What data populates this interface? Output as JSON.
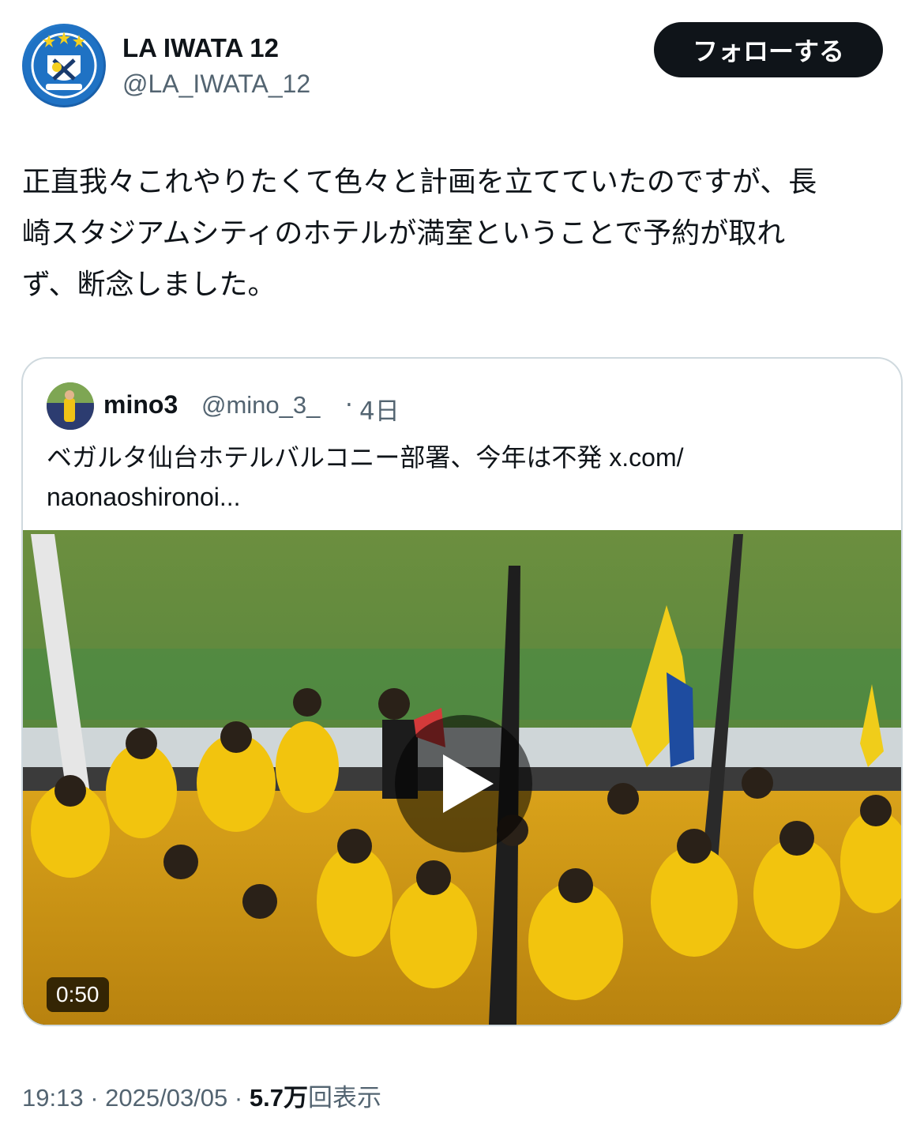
{
  "author": {
    "name": "LA IWATA 12",
    "handle": "@LA_IWATA_12",
    "avatar_icon": "jubilo-iwata-crest-icon",
    "follow_label": "フォローする"
  },
  "tweet": {
    "text": "正直我々これやりたくて色々と計画を立てていたのですが、長\n崎スタジアムシティのホテルが満室ということで予約が取れ\nず、断念しました。"
  },
  "quoted": {
    "name": "mino3",
    "handle": "@mino_3_",
    "dot": "·",
    "time": "4日",
    "text_lines": [
      "ベガルタ仙台ホテルバルコニー部署、今年は不発 x.com/",
      "naonaoshironoi..."
    ],
    "video_duration": "0:50",
    "play_icon": "play-icon"
  },
  "meta": {
    "time": "19:13",
    "date": "2025/03/05",
    "views_value": "5.7万",
    "views_label": "回表示",
    "sep": " · "
  },
  "colors": {
    "text_primary": "#0f1419",
    "text_secondary": "#536471",
    "border": "#cfd9de",
    "follow_bg": "#0f1419",
    "supporter_yellow": "#f0c316"
  }
}
